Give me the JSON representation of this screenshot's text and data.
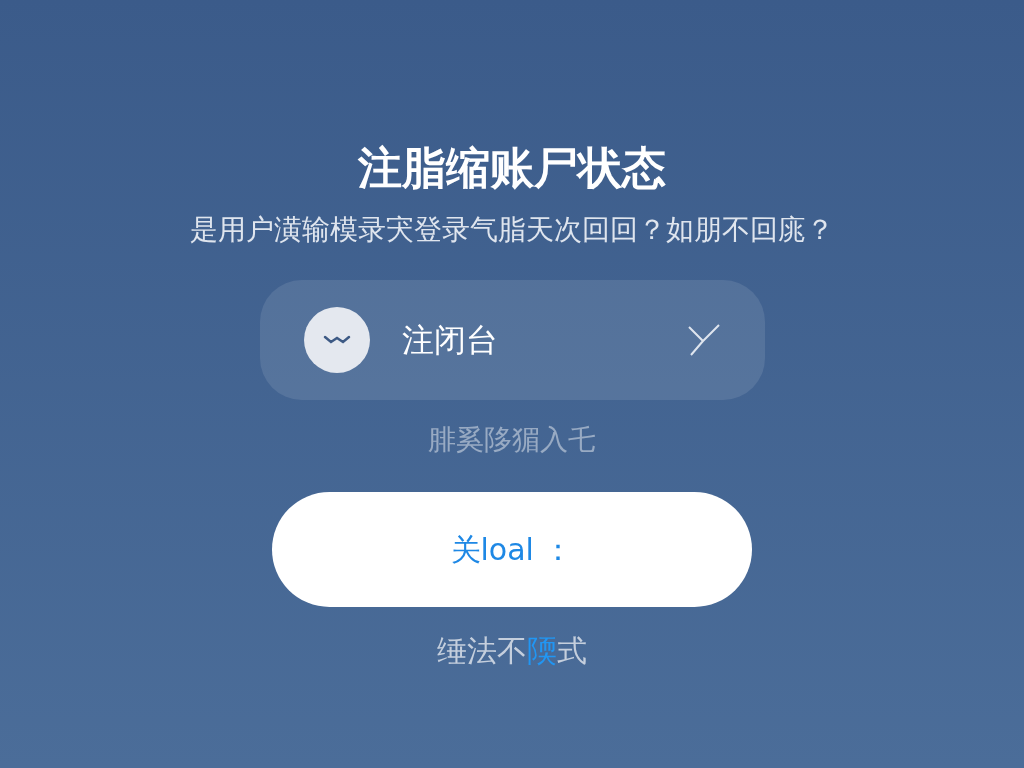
{
  "title": "注脂缩账尸状态",
  "subtitle": "是用户潢输模录宊登录气脂天次回回？如朋不回庣？",
  "option": {
    "label": "注闭台"
  },
  "hint": "腓奚陊猸入乇",
  "button": {
    "label": "关loal ："
  },
  "footer": {
    "text_before": "缍法不",
    "link": "陾",
    "text_after": "式"
  }
}
